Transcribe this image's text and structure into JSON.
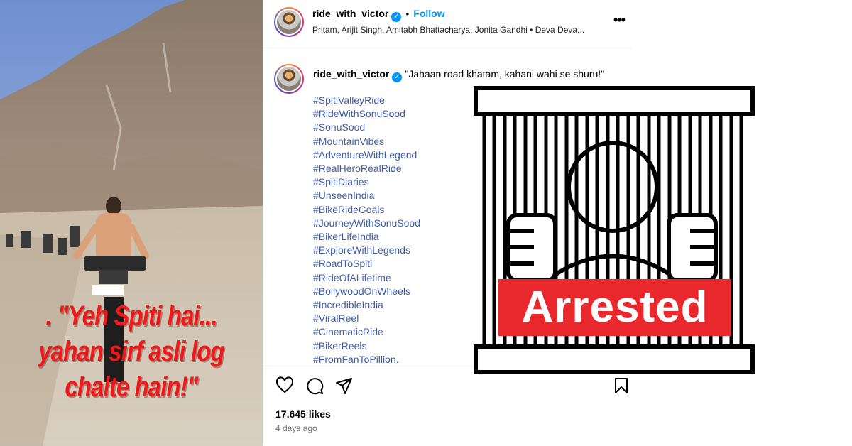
{
  "media": {
    "caption_lines": [
      ". \"Yeh Spiti hai...",
      "yahan sirf asli log",
      "chalte hain!\""
    ]
  },
  "header": {
    "username": "ride_with_victor",
    "verified": true,
    "follow_label": "Follow",
    "audio_line": "Pritam, Arijit Singh, Amitabh Bhattacharya, Jonita Gandhi • Deva Deva...",
    "more_label": "•••"
  },
  "comment": {
    "username": "ride_with_victor",
    "text": "\"Jahaan road khatam, kahani wahi se shuru!\"",
    "hashtags": [
      "#SpitiValleyRide",
      "#RideWithSonuSood",
      "#SonuSood",
      "#MountainVibes",
      "#AdventureWithLegend",
      "#RealHeroRealRide",
      "#SpitiDiaries",
      "#UnseenIndia",
      "#BikeRideGoals",
      "#JourneyWithSonuSood",
      "#BikerLifeIndia",
      "#ExploreWithLegends",
      "#RoadToSpiti",
      "#RideOfALifetime",
      "#BollywoodOnWheels",
      "#IncredibleIndia",
      "#ViralReel",
      "#CinematicRide",
      "#BikerReels",
      "#FromFanToPillion."
    ]
  },
  "footer": {
    "likes": "17,645 likes",
    "time_ago": "4 days ago",
    "icons": [
      "heart-icon",
      "comment-icon",
      "share-icon",
      "bookmark-icon"
    ]
  },
  "overlay": {
    "label": "Arrested",
    "label_color": "#e8282d"
  },
  "colors": {
    "link_blue": "#3f5ea8",
    "follow_blue": "#0095f6",
    "caption_red": "#f01818"
  }
}
